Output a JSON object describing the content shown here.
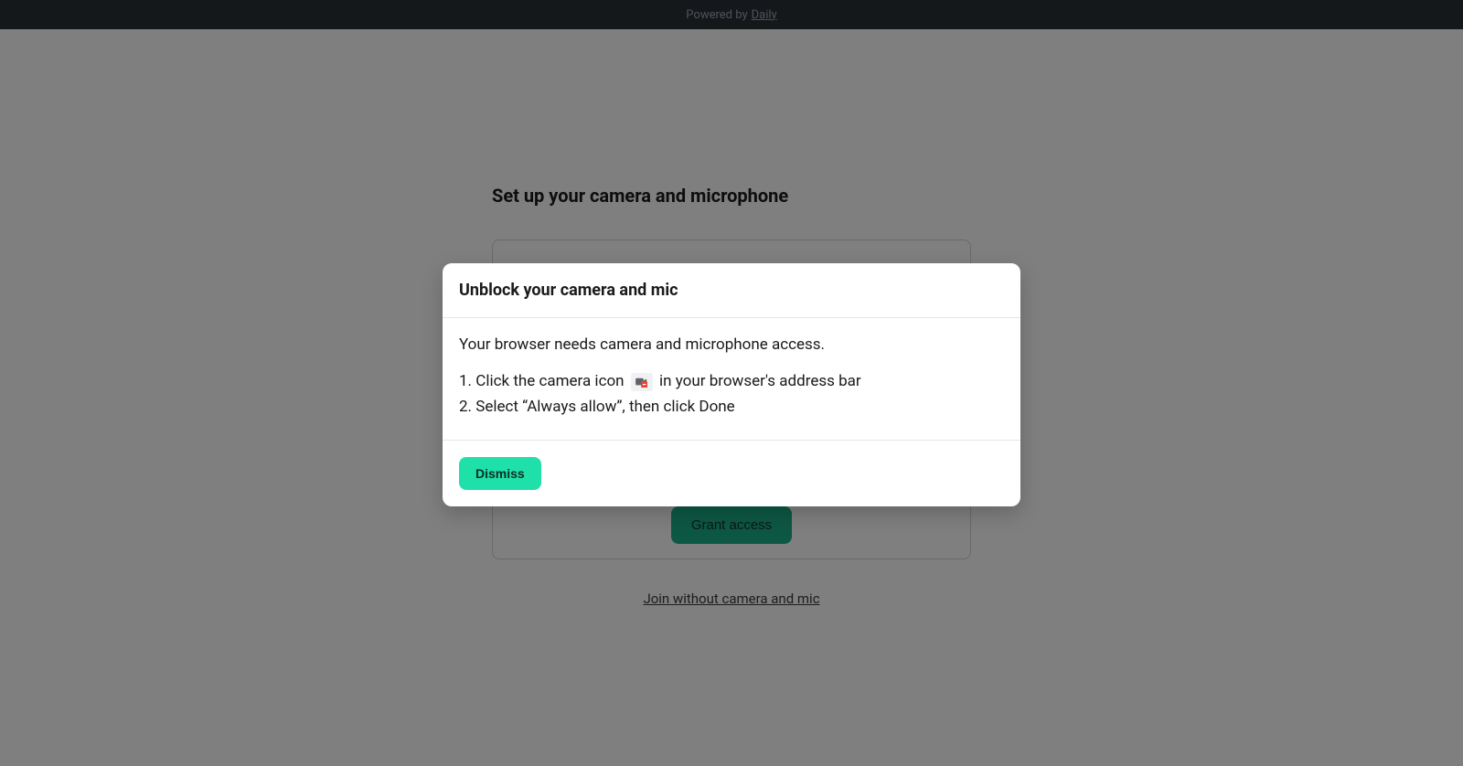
{
  "banner": {
    "prefix": "Powered by ",
    "link_text": "Daily"
  },
  "setup": {
    "title": "Set up your camera and microphone",
    "grant_access_label": "Grant access",
    "join_without_label": "Join without camera and mic"
  },
  "modal": {
    "title": "Unblock your camera and mic",
    "body_text": "Your browser needs camera and microphone access.",
    "step1_prefix": "1. Click the camera icon ",
    "step1_suffix": " in your browser's address bar",
    "step2": "2. Select “Always allow”, then click Done",
    "dismiss_label": "Dismiss"
  }
}
